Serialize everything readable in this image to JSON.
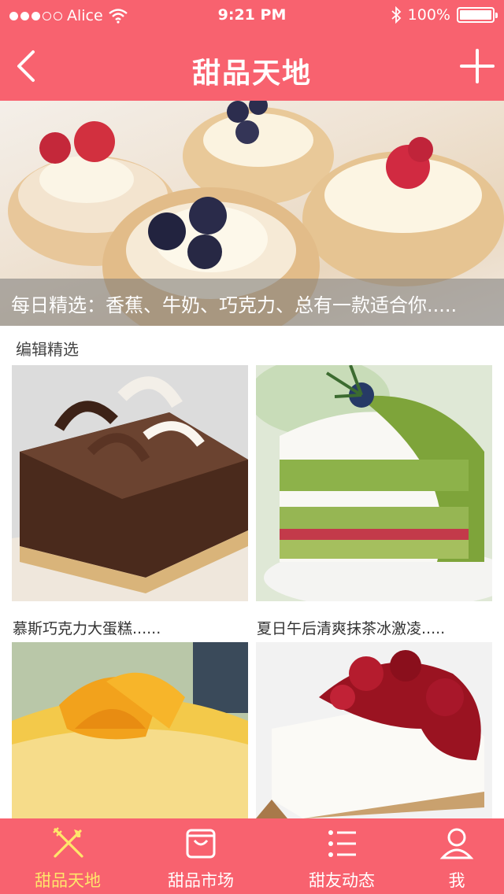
{
  "status_bar": {
    "carrier": "Alice",
    "time": "9:21 PM",
    "battery": "100%",
    "signal_dots_filled": 3,
    "signal_dots_total": 5
  },
  "nav": {
    "title": "甜品天地",
    "back_icon": "chevron-left-icon",
    "add_icon": "plus-icon"
  },
  "hero": {
    "caption": "每日精选：香蕉、牛奶、巧克力、总有一款适合你....."
  },
  "section": {
    "title": "编辑精选"
  },
  "items": [
    {
      "label": "慕斯巧克力大蛋糕......"
    },
    {
      "label": "夏日午后清爽抹茶冰激凌....."
    },
    {
      "label": ""
    },
    {
      "label": ""
    }
  ],
  "tabs": [
    {
      "label": "甜品天地",
      "icon": "fork-knife-icon",
      "active": true
    },
    {
      "label": "甜品市场",
      "icon": "shopping-bag-icon",
      "active": false
    },
    {
      "label": "甜友动态",
      "icon": "list-icon",
      "active": false
    },
    {
      "label": "我",
      "icon": "user-icon",
      "active": false
    }
  ],
  "colors": {
    "primary": "#f8626f",
    "active_tab": "#ffe66b"
  }
}
